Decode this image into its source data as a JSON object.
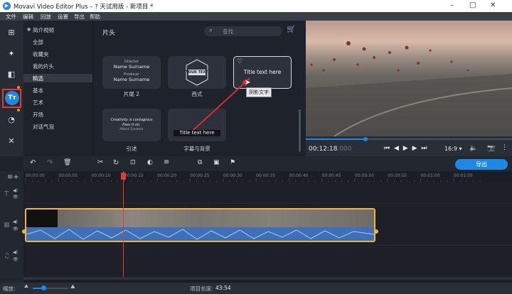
{
  "titlebar": {
    "title": "Movavi Video Editor Plus – ? 天试用版 - 新项目 *",
    "minimize": "–",
    "maximize": "□",
    "close": "✕"
  },
  "menu": [
    "文件",
    "编辑",
    "回放",
    "设置",
    "导出",
    "帮助"
  ],
  "sidebar_tools": [
    "import-icon",
    "magic-wand-icon",
    "filters-icon",
    "titles-icon",
    "transitions-icon",
    "more-tools-icon"
  ],
  "categories": {
    "items": [
      "简介视频",
      "全部",
      "收藏夹",
      "我的片头",
      "精选",
      "基本",
      "艺术",
      "开场",
      "对话气泡"
    ],
    "selected": "精选"
  },
  "gallery": {
    "heading": "片头",
    "search_placeholder": "查找",
    "tiles": [
      {
        "label": "片尾 2",
        "lines": [
          "Director",
          "Name Surname",
          "Producer",
          "Name Surname"
        ]
      },
      {
        "label": "西式",
        "lines": [
          "YOUR TEXT"
        ]
      },
      {
        "label": "",
        "lines": [
          "Title text here"
        ]
      },
      {
        "label": "引述",
        "lines": [
          "Creativity is contagious",
          "Pass it on.",
          "Albert Einstein"
        ]
      },
      {
        "label": "字幕与背景",
        "lines": [
          "Title text here"
        ]
      }
    ],
    "tooltip": "阴影文字"
  },
  "player": {
    "time_main": "00:12:18",
    "time_frac": ".000",
    "aspect": "16:9",
    "progress": 0.29
  },
  "timeline": {
    "export_label": "导出",
    "ruler": [
      "00:00:00",
      "00:00:05",
      "00:00:10",
      "00:00:15",
      "00:00:20",
      "00:00:25",
      "00:00:30",
      "00:00:35",
      "00:00:40",
      "00:00:45",
      "00:00:50",
      "00:00:55",
      "00:01:00",
      "00:01:05"
    ],
    "playhead_time": "00:00:12"
  },
  "status": {
    "zoom_label": "缩放:",
    "project_length_label": "项目长度:",
    "project_length": "43:54"
  },
  "colors": {
    "accent": "#1e88e5",
    "clip_border": "#f2b632",
    "highlight": "#e53935",
    "arrow": "#d32f2f"
  }
}
